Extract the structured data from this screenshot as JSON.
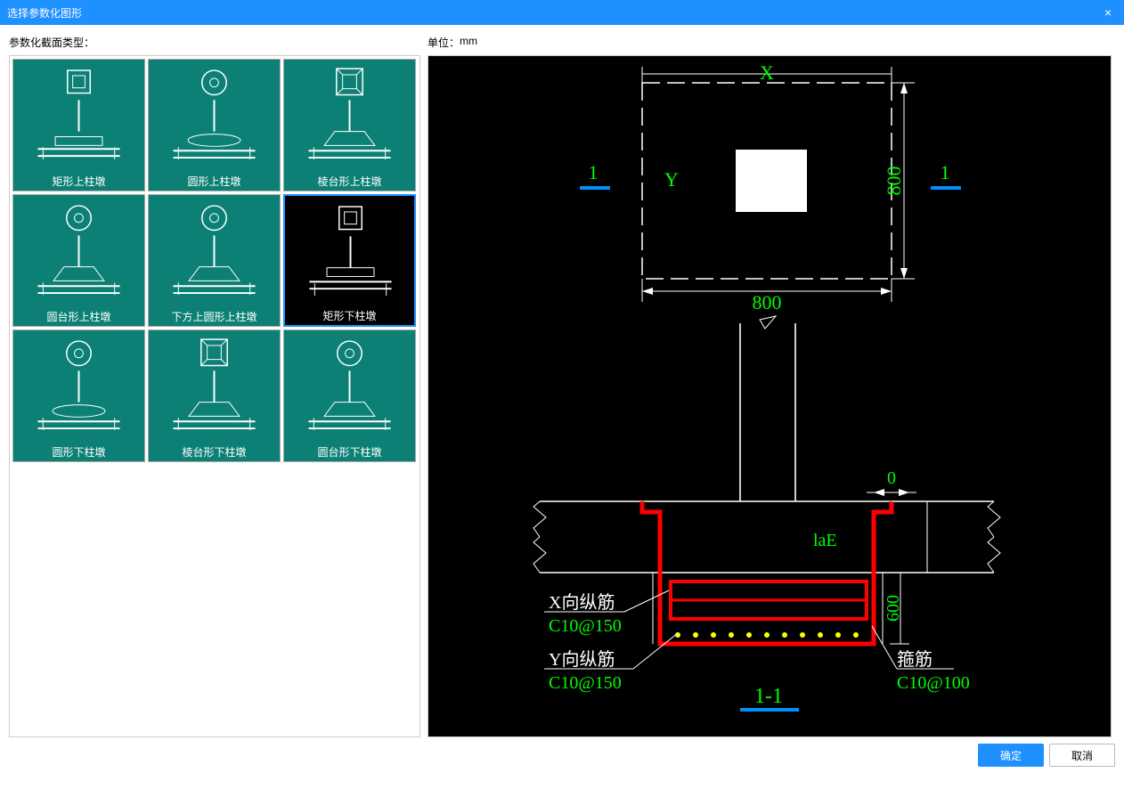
{
  "window": {
    "title": "选择参数化图形"
  },
  "labels": {
    "section_type": "参数化截面类型：",
    "unit_label": "单位：",
    "unit_value": "mm"
  },
  "thumbs": [
    {
      "label": "矩形上柱墩",
      "shape": "rect_top",
      "selected": false
    },
    {
      "label": "圆形上柱墩",
      "shape": "circle_top",
      "selected": false
    },
    {
      "label": "棱台形上柱墩",
      "shape": "prism_top",
      "selected": false
    },
    {
      "label": "圆台形上柱墩",
      "shape": "cone_top",
      "selected": false
    },
    {
      "label": "下方上圆形上柱墩",
      "shape": "sq_circ_top",
      "selected": false
    },
    {
      "label": "矩形下柱墩",
      "shape": "rect_bot",
      "selected": true
    },
    {
      "label": "圆形下柱墩",
      "shape": "circle_bot",
      "selected": false
    },
    {
      "label": "棱台形下柱墩",
      "shape": "prism_bot",
      "selected": false
    },
    {
      "label": "圆台形下柱墩",
      "shape": "cone_bot",
      "selected": false
    }
  ],
  "preview": {
    "plan": {
      "x_label": "X",
      "y_label": "Y",
      "width": "800",
      "height": "800",
      "section_mark_left": "1",
      "section_mark_right": "1"
    },
    "section": {
      "top_dim": "0",
      "anchor_label": "laE",
      "x_rebar_label": "X向纵筋",
      "x_rebar_value": "C10@150",
      "y_rebar_label": "Y向纵筋",
      "y_rebar_value": "C10@150",
      "stirrup_label": "箍筋",
      "stirrup_value": "C10@100",
      "depth": "600",
      "section_id": "1-1"
    }
  },
  "buttons": {
    "ok": "确定",
    "cancel": "取消"
  }
}
